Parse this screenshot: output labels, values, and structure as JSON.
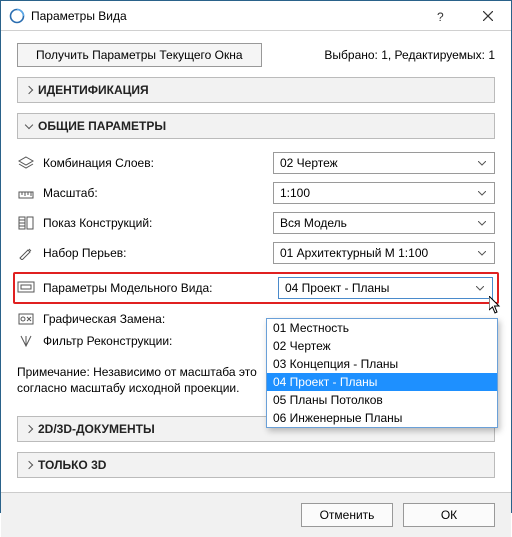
{
  "titlebar": {
    "title": "Параметры Вида"
  },
  "top": {
    "get_current_window": "Получить Параметры Текущего Окна",
    "status": "Выбрано: 1, Редактируемых: 1"
  },
  "sections": {
    "identification": "ИДЕНТИФИКАЦИЯ",
    "general": "ОБЩИЕ ПАРАМЕТРЫ",
    "docs2d3d": "2D/3D-ДОКУМЕНТЫ",
    "only3d": "ТОЛЬКО 3D"
  },
  "general": {
    "layer_combo_label": "Комбинация Слоев:",
    "layer_combo_value": "02 Чертеж",
    "scale_label": "Масштаб:",
    "scale_value": "1:100",
    "display_label": "Показ Конструкций:",
    "display_value": "Вся Модель",
    "penset_label": "Набор Перьев:",
    "penset_value": "01 Архитектурный М 1:100",
    "mvo_label": "Параметры Модельного Вида:",
    "mvo_value": "04 Проект - Планы",
    "override_label": "Графическая Замена:",
    "renov_label": "Фильтр Реконструкции:"
  },
  "dropdown": {
    "items": [
      "01 Местность",
      "02 Чертеж",
      "03 Концепция - Планы",
      "04 Проект - Планы",
      "05 Планы Потолков",
      "06 Инженерные Планы"
    ],
    "selected_index": 3
  },
  "note": "Примечание: Независимо от масштаба этого вида, элементы ГКС всегда отображаются согласно масштабу исходной проекции.",
  "footer": {
    "cancel": "Отменить",
    "ok": "ОК"
  }
}
